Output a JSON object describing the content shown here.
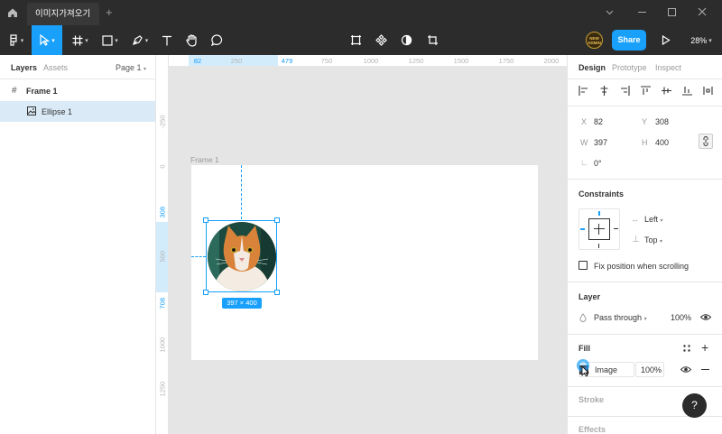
{
  "titlebar": {
    "tab_title": "이미지가져오기",
    "new_tab": "+",
    "window_controls": [
      "minimize",
      "maximize",
      "close"
    ]
  },
  "toolbar": {
    "share_label": "Share",
    "zoom": "28%",
    "avatar_text": "NEW ADMIN",
    "accent": "#18a0fb"
  },
  "layers_panel": {
    "tab_layers": "Layers",
    "tab_assets": "Assets",
    "page": "Page 1",
    "items": [
      {
        "name": "Frame 1",
        "icon": "frame-icon"
      },
      {
        "name": "Ellipse 1",
        "icon": "image-icon",
        "selected": true
      }
    ]
  },
  "ruler": {
    "top": [
      "82",
      "250",
      "479",
      "750",
      "1000",
      "1250",
      "1500",
      "1750",
      "2000"
    ],
    "left": [
      "-250",
      "0",
      "308",
      "500",
      "708",
      "1000",
      "1250"
    ]
  },
  "canvas": {
    "frame_label": "Frame 1",
    "size_badge": "397 × 400"
  },
  "design_panel": {
    "tabs": [
      "Design",
      "Prototype",
      "Inspect"
    ],
    "x_label": "X",
    "x": "82",
    "y_label": "Y",
    "y": "308",
    "w_label": "W",
    "w": "397",
    "h_label": "H",
    "h": "400",
    "rotation_label": "∟",
    "rotation": "0°",
    "constraints_title": "Constraints",
    "constraint_h": "Left",
    "constraint_v": "Top",
    "fix_position_label": "Fix position when scrolling",
    "layer_title": "Layer",
    "blend_mode": "Pass through",
    "layer_opacity": "100%",
    "fill_title": "Fill",
    "fill_type": "Image",
    "fill_opacity": "100%",
    "stroke_title": "Stroke",
    "effects_title": "Effects",
    "help_label": "?"
  }
}
